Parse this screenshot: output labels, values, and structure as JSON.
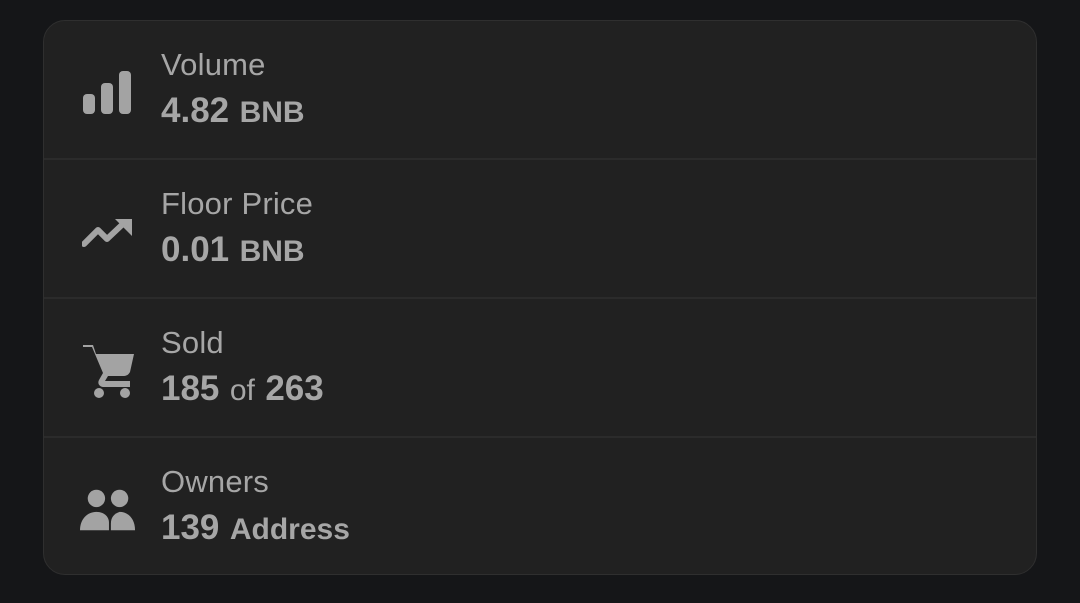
{
  "stats": {
    "volume": {
      "icon": "bar-chart-icon",
      "label": "Volume",
      "value": "4.82",
      "unit": "BNB"
    },
    "floor_price": {
      "icon": "trending-up-icon",
      "label": "Floor Price",
      "value": "0.01",
      "unit": "BNB"
    },
    "sold": {
      "icon": "cart-icon",
      "label": "Sold",
      "value": "185",
      "separator": "of",
      "total": "263"
    },
    "owners": {
      "icon": "people-icon",
      "label": "Owners",
      "value": "139",
      "unit": "Address"
    }
  },
  "colors": {
    "background": "#151618",
    "card": "#212121",
    "divider": "#2b2b2b",
    "text": "#a6a6a6"
  }
}
